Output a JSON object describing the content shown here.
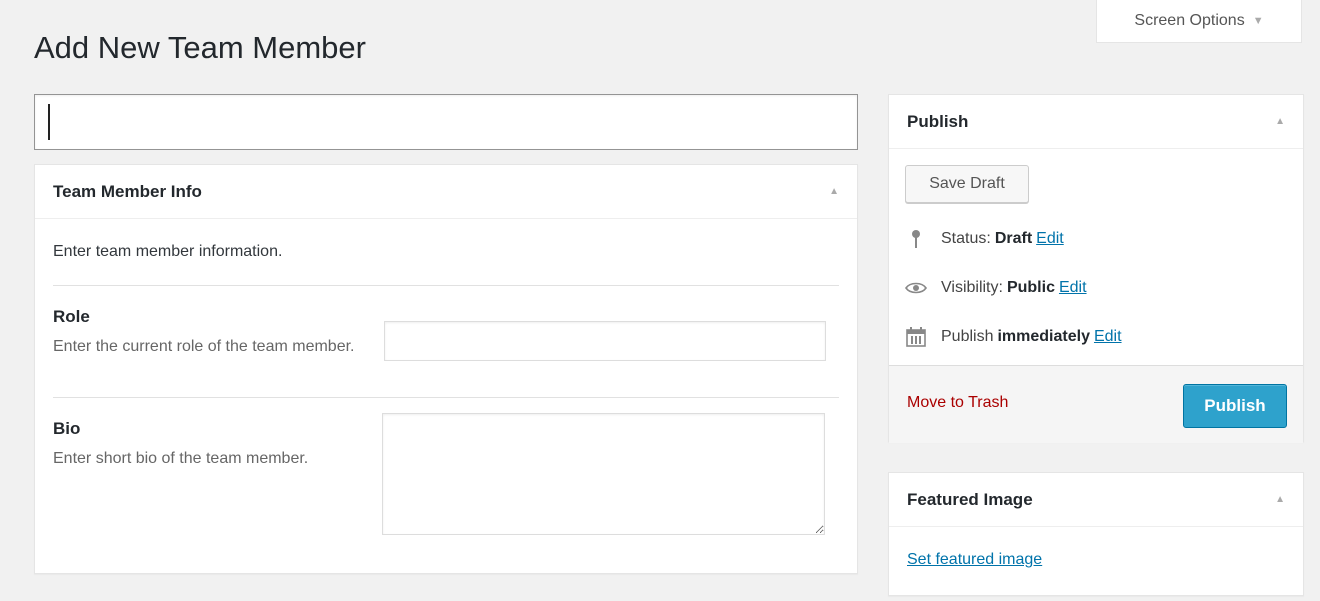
{
  "screen_options": {
    "label": "Screen Options",
    "arrow": "▼"
  },
  "page": {
    "title": "Add New Team Member"
  },
  "title_field": {
    "value": "",
    "placeholder": ""
  },
  "team_member_box": {
    "title": "Team Member Info",
    "toggle": "▲",
    "description": "Enter team member information.",
    "fields": [
      {
        "label": "Role",
        "help": "Enter the current role of the team member.",
        "value": ""
      },
      {
        "label": "Bio",
        "help": "Enter short bio of the team member.",
        "value": ""
      }
    ]
  },
  "publish_box": {
    "title": "Publish",
    "toggle": "▲",
    "save_draft": "Save Draft",
    "status": {
      "prefix": "Status:",
      "value": "Draft",
      "edit": "Edit",
      "icon": "pin-icon"
    },
    "visibility": {
      "prefix": "Visibility:",
      "value": "Public",
      "edit": "Edit",
      "icon": "eye-icon"
    },
    "schedule": {
      "prefix": "Publish",
      "value": "immediately",
      "edit": "Edit",
      "icon": "calendar-icon"
    },
    "trash": "Move to Trash",
    "publish": "Publish"
  },
  "featured_image_box": {
    "title": "Featured Image",
    "toggle": "▲",
    "link": "Set featured image"
  },
  "colors": {
    "accent": "#2ea2cc",
    "link": "#0073aa",
    "danger": "#a00000",
    "background": "#f1f1f1"
  }
}
